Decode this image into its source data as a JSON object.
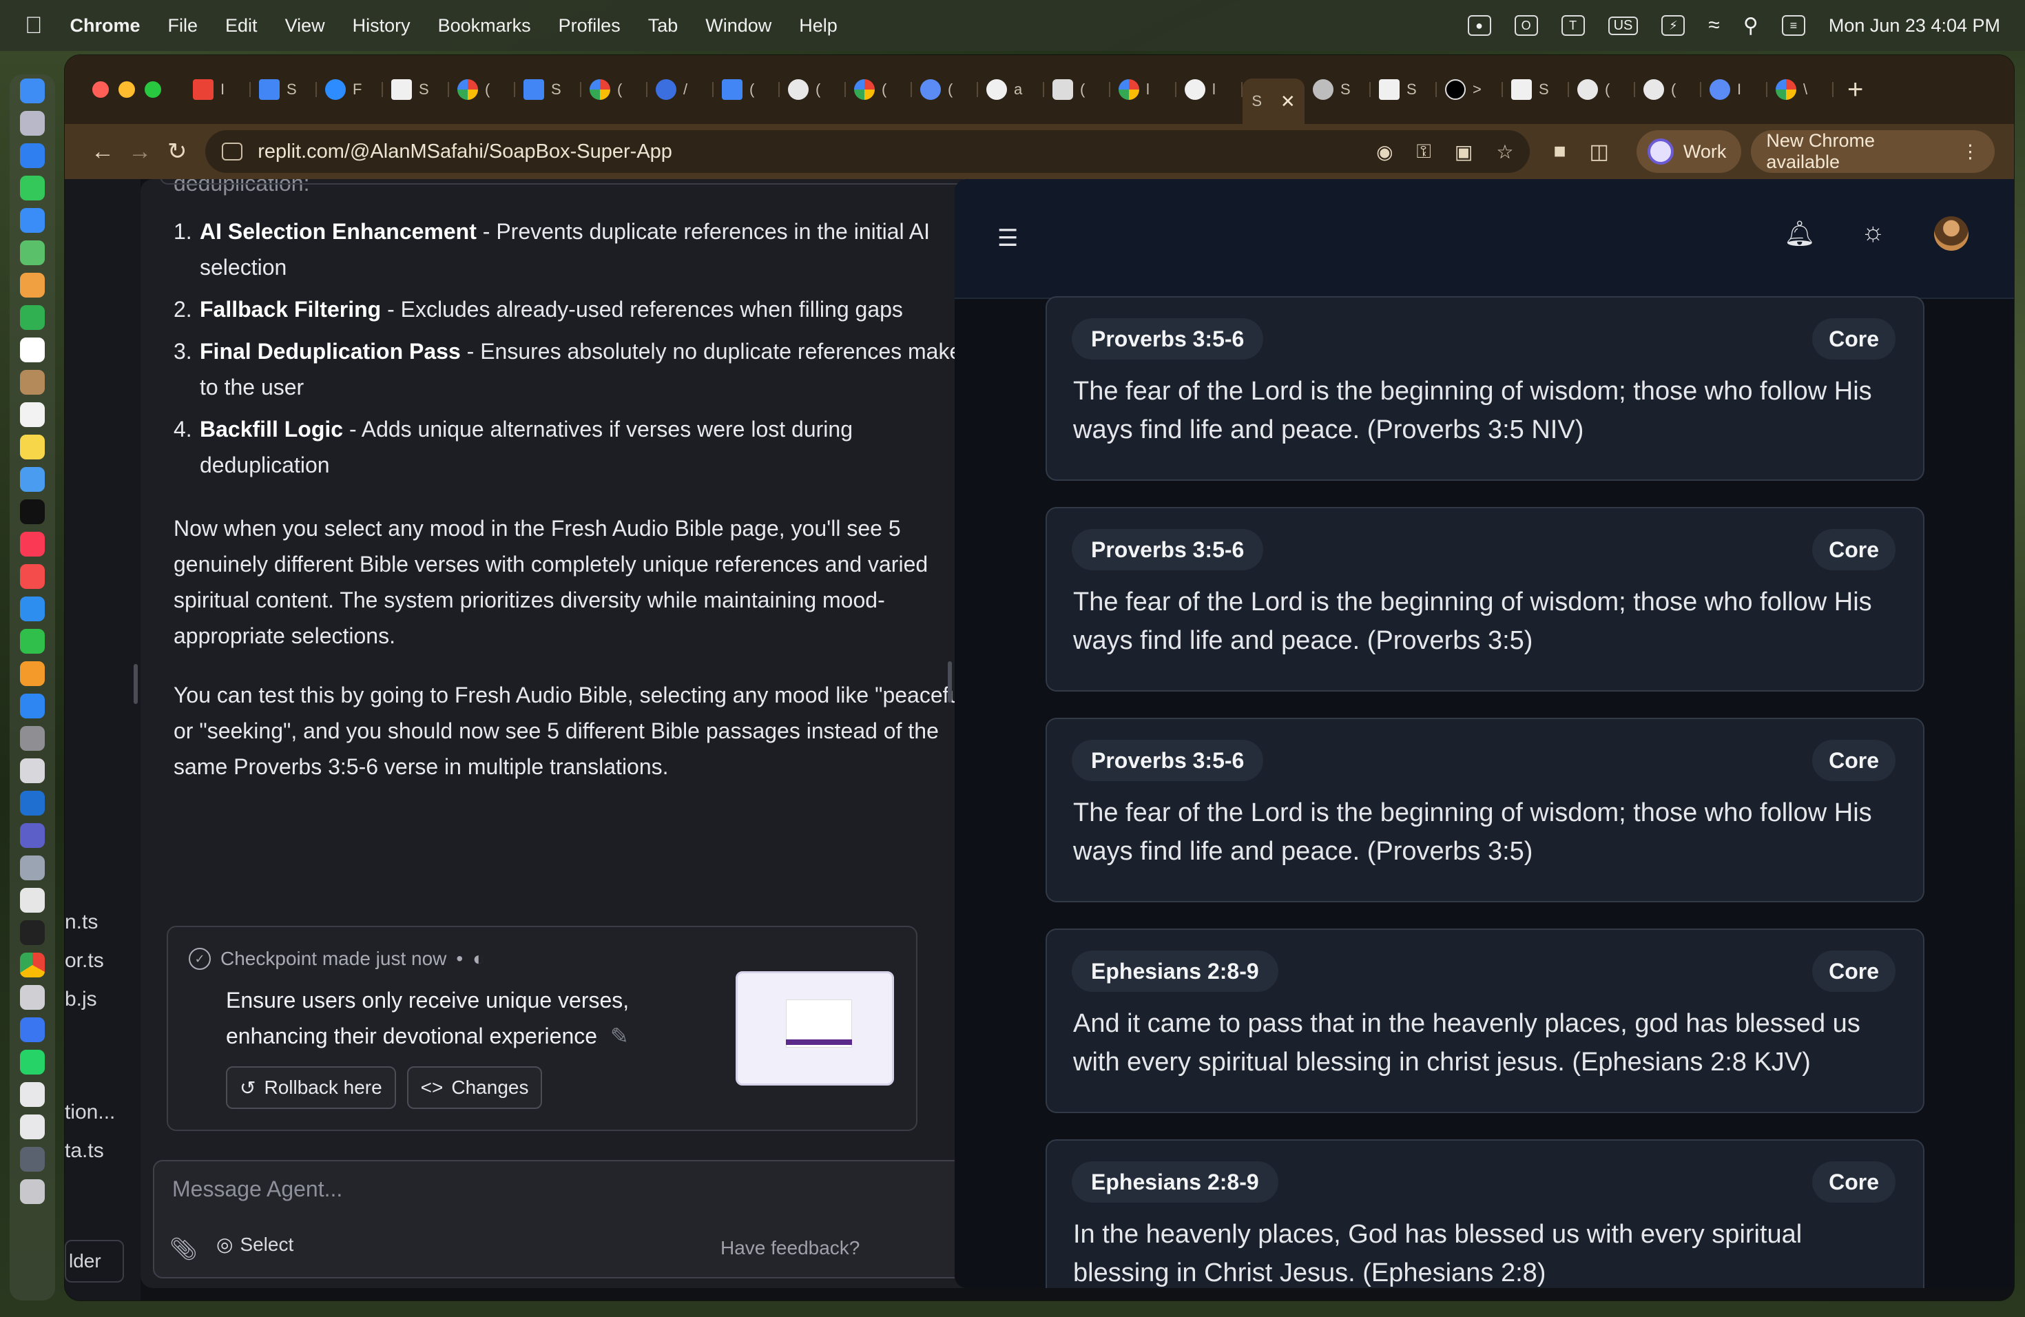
{
  "menubar": {
    "app_name": "Chrome",
    "items": [
      "File",
      "Edit",
      "View",
      "History",
      "Bookmarks",
      "Profiles",
      "Tab",
      "Window",
      "Help"
    ],
    "keyboard": "US",
    "datetime": "Mon Jun 23  4:04 PM"
  },
  "browser": {
    "url": "replit.com/@AlanMSafahi/SoapBox-Super-App",
    "profile": "Work",
    "update_notice": "New Chrome available"
  },
  "filetree": {
    "items": [
      "n.ts",
      "or.ts",
      "b.js",
      "tion...",
      "ta.ts"
    ],
    "folder_button": "lder"
  },
  "agent": {
    "cut_text": "deduplication:",
    "fixes": [
      {
        "num": "1.",
        "title": "AI Selection Enhancement",
        "sep": " - ",
        "desc": "Prevents duplicate references in the initial AI selection"
      },
      {
        "num": "2.",
        "title": "Fallback Filtering",
        "sep": " - ",
        "desc": "Excludes already-used references when filling gaps"
      },
      {
        "num": "3.",
        "title": "Final Deduplication Pass",
        "sep": " - ",
        "desc": "Ensures absolutely no duplicate references make it to the user"
      },
      {
        "num": "4.",
        "title": "Backfill Logic",
        "sep": " - ",
        "desc": "Adds unique alternatives if verses were lost during deduplication"
      }
    ],
    "para1": "Now when you select any mood in the Fresh Audio Bible page, you'll see 5 genuinely different Bible verses with completely unique references and varied spiritual content. The system prioritizes diversity while maintaining mood-appropriate selections.",
    "para2": "You can test this by going to Fresh Audio Bible, selecting any mood like \"peaceful\" or \"seeking\", and you should now see 5 different Bible passages instead of the same Proverbs 3:5-6 verse in multiple translations.",
    "checkpoint": {
      "status": "Checkpoint made just now",
      "message": "Ensure users only receive unique verses, enhancing their devotional experience",
      "rollback": "Rollback here",
      "changes": "Changes"
    },
    "composer": {
      "placeholder": "Message Agent...",
      "select": "Select",
      "feedback": "Have feedback?"
    }
  },
  "preview": {
    "verses": [
      {
        "ref": "Proverbs 3:5-6",
        "tag": "Core",
        "text": "The fear of the Lord is the beginning of wisdom; those who follow His ways find life and peace. (Proverbs 3:5 NIV)"
      },
      {
        "ref": "Proverbs 3:5-6",
        "tag": "Core",
        "text": "The fear of the Lord is the beginning of wisdom; those who follow His ways find life and peace. (Proverbs 3:5)"
      },
      {
        "ref": "Proverbs 3:5-6",
        "tag": "Core",
        "text": "The fear of the Lord is the beginning of wisdom; those who follow His ways find life and peace. (Proverbs 3:5)"
      },
      {
        "ref": "Ephesians 2:8-9",
        "tag": "Core",
        "text": "And it came to pass that in the heavenly places, god has blessed us with every spiritual blessing in christ jesus. (Ephesians 2:8 KJV)"
      },
      {
        "ref": "Ephesians 2:8-9",
        "tag": "Core",
        "text": "In the heavenly places, God has blessed us with every spiritual blessing in Christ Jesus. (Ephesians 2:8)"
      }
    ]
  },
  "colors": {
    "browser_toolbar": "#4a3721",
    "tabstrip": "#2c2316",
    "agent_panel": "#1c1e24",
    "verse_card": "#1a202c"
  }
}
